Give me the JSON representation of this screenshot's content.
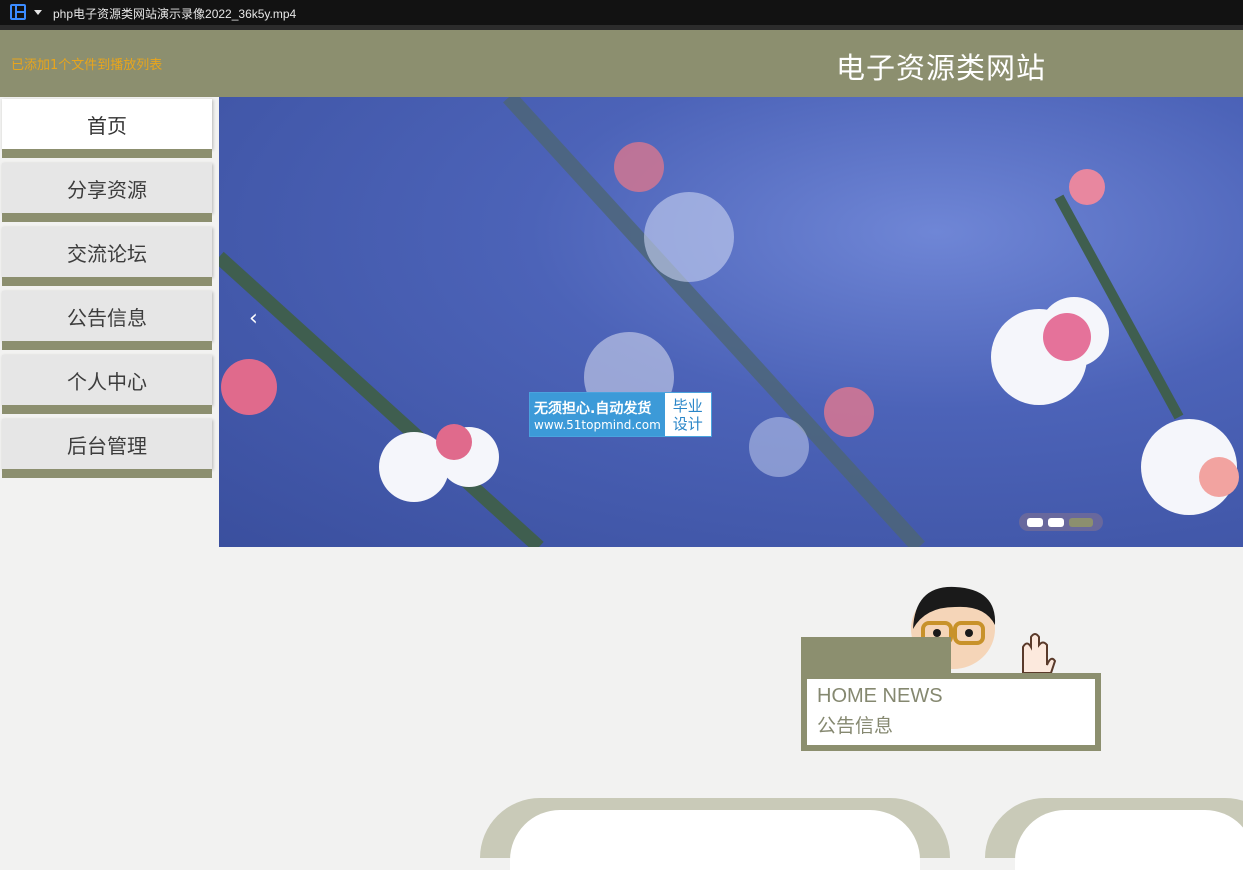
{
  "window": {
    "title": "php电子资源类网站演示录像2022_36k5y.mp4"
  },
  "header": {
    "notice": "已添加1个文件到播放列表",
    "site_title": "电子资源类网站"
  },
  "nav": {
    "items": [
      {
        "label": "首页",
        "active": true
      },
      {
        "label": "分享资源",
        "active": false
      },
      {
        "label": "交流论坛",
        "active": false
      },
      {
        "label": "公告信息",
        "active": false
      },
      {
        "label": "个人中心",
        "active": false
      },
      {
        "label": "后台管理",
        "active": false
      }
    ]
  },
  "banner": {
    "prev_icon": "chevron-left-icon",
    "watermark": {
      "line1": "无须担心.自动发货",
      "line2": "www.51topmind.com",
      "side_top": "毕业",
      "side_bottom": "设计"
    },
    "slide_count": 3,
    "active_slide": 3
  },
  "news": {
    "title_en": "HOME NEWS",
    "title_cn": "公告信息"
  },
  "colors": {
    "accent": "#8c8f6f",
    "notice": "#e8a51c"
  }
}
